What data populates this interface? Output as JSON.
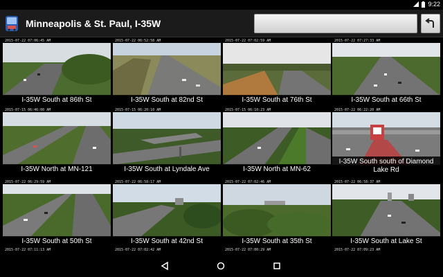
{
  "status_bar": {
    "time": "9:22"
  },
  "action_bar": {
    "title": "Minneapolis & St. Paul, I-35W",
    "search_value": ""
  },
  "cameras": [
    {
      "timestamp": "2015-07-22 07:06:45 AM",
      "label": "I-35W South at 86th St"
    },
    {
      "timestamp": "2015-07-22 06:52:58 AM",
      "label": "I-35W South at 82nd St"
    },
    {
      "timestamp": "2015-07-22 07:02:59 AM",
      "label": "I-35W South at 76th St"
    },
    {
      "timestamp": "2015-07-22 07:27:33 AM",
      "label": "I-35W South at 66th St"
    },
    {
      "timestamp": "2015-07-15 06:46:00 AM",
      "label": "I-35W North at MN-121"
    },
    {
      "timestamp": "2015-07-15 06:20:10 AM",
      "label": "I-35W South at Lyndale Ave"
    },
    {
      "timestamp": "2015-07-15 06:10:23 AM",
      "label": "I-35W North at MN-62"
    },
    {
      "timestamp": "2015-07-22 06:22:20 AM",
      "label": "I-35W South south of Diamond Lake Rd"
    },
    {
      "timestamp": "2015-07-22 06:29:59 AM",
      "label": "I-35W South at 50th St"
    },
    {
      "timestamp": "2015-07-22 06:58:17 AM",
      "label": "I-35W South at 42nd St"
    },
    {
      "timestamp": "2015-07-22 07:02:46 AM",
      "label": "I-35W South at 35th St"
    },
    {
      "timestamp": "2015-07-22 06:58:37 AM",
      "label": "I-35W South at Lake St"
    }
  ],
  "partial_row": [
    {
      "timestamp": "2015-07-22 07:11:13 AM"
    },
    {
      "timestamp": "2015-07-22 07:02:42 AM"
    },
    {
      "timestamp": "2015-07-22 07:00:29 AM"
    },
    {
      "timestamp": "2015-07-22 07:09:23 AM"
    }
  ],
  "icons": {
    "app": "traffic-camera-icon",
    "back": "undo-arrow-icon",
    "nav_back": "triangle-back-icon",
    "nav_home": "circle-home-icon",
    "nav_recents": "square-recents-icon",
    "status": [
      "signal-icon",
      "battery-icon"
    ]
  },
  "colors": {
    "action_bar_bg": "#1b1b1b",
    "label_overlay": "#000000",
    "label_text": "#ffffff"
  }
}
